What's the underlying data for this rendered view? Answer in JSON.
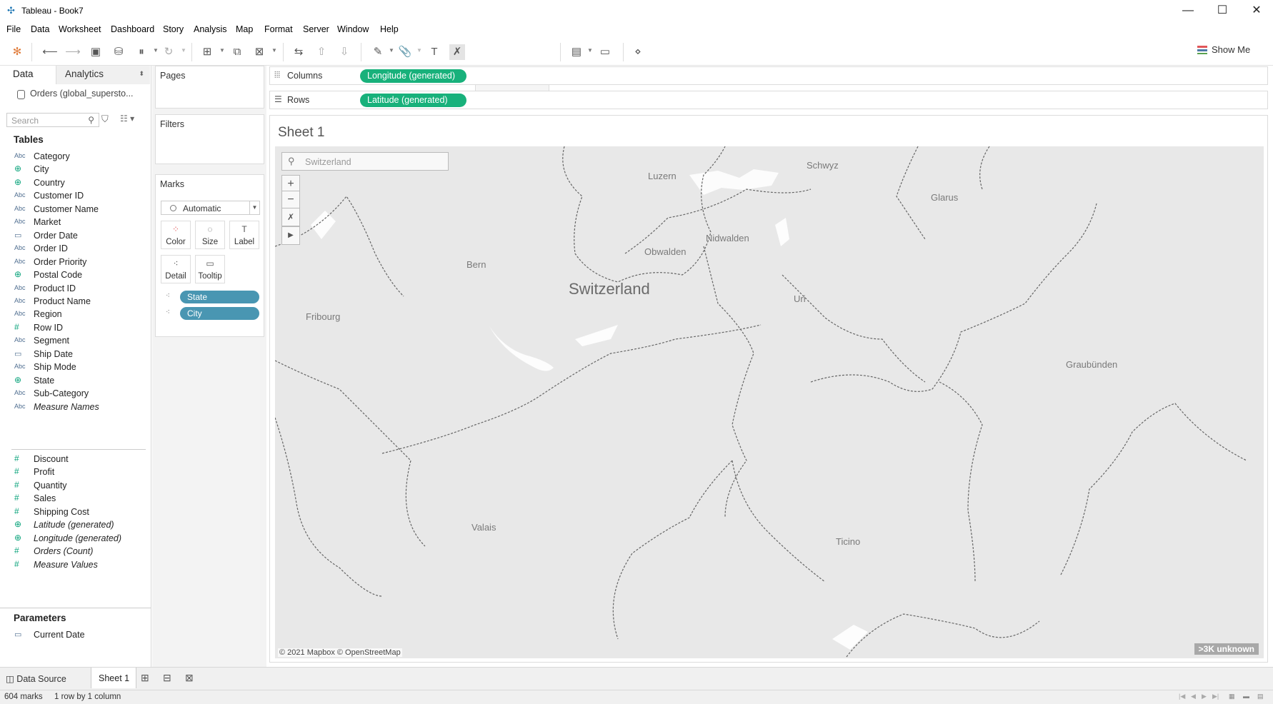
{
  "window": {
    "title": "Tableau - Book7",
    "minimize": "—",
    "maximize": "☐",
    "close": "✕"
  },
  "menu": [
    "File",
    "Data",
    "Worksheet",
    "Dashboard",
    "Story",
    "Analysis",
    "Map",
    "Format",
    "Server",
    "Window",
    "Help"
  ],
  "toolbar": {
    "show_me": "Show Me"
  },
  "data_pane": {
    "tab_data": "Data",
    "tab_analytics": "Analytics",
    "datasource": "Orders (global_supersto...",
    "search_placeholder": "Search",
    "tables_header": "Tables",
    "dimensions": [
      {
        "type": "Abc",
        "name": "Category"
      },
      {
        "type": "geo",
        "name": "City"
      },
      {
        "type": "geo",
        "name": "Country"
      },
      {
        "type": "Abc",
        "name": "Customer ID"
      },
      {
        "type": "Abc",
        "name": "Customer Name"
      },
      {
        "type": "Abc",
        "name": "Market"
      },
      {
        "type": "cal",
        "name": "Order Date"
      },
      {
        "type": "Abc",
        "name": "Order ID"
      },
      {
        "type": "Abc",
        "name": "Order Priority"
      },
      {
        "type": "geo",
        "name": "Postal Code"
      },
      {
        "type": "Abc",
        "name": "Product ID"
      },
      {
        "type": "Abc",
        "name": "Product Name"
      },
      {
        "type": "Abc",
        "name": "Region"
      },
      {
        "type": "num",
        "name": "Row ID"
      },
      {
        "type": "Abc",
        "name": "Segment"
      },
      {
        "type": "cal",
        "name": "Ship Date"
      },
      {
        "type": "Abc",
        "name": "Ship Mode"
      },
      {
        "type": "geo",
        "name": "State"
      },
      {
        "type": "Abc",
        "name": "Sub-Category"
      },
      {
        "type": "Abc",
        "name": "Measure Names",
        "italic": true
      }
    ],
    "measures": [
      {
        "type": "num",
        "name": "Discount"
      },
      {
        "type": "num",
        "name": "Profit"
      },
      {
        "type": "num",
        "name": "Quantity"
      },
      {
        "type": "num",
        "name": "Sales"
      },
      {
        "type": "num",
        "name": "Shipping Cost"
      },
      {
        "type": "geo",
        "name": "Latitude (generated)",
        "italic": true
      },
      {
        "type": "geo",
        "name": "Longitude (generated)",
        "italic": true
      },
      {
        "type": "num",
        "name": "Orders (Count)",
        "italic": true
      },
      {
        "type": "num",
        "name": "Measure Values",
        "italic": true
      }
    ],
    "parameters_header": "Parameters",
    "parameters": [
      {
        "type": "cal",
        "name": "Current Date"
      }
    ]
  },
  "cards": {
    "pages": "Pages",
    "filters": "Filters",
    "marks": "Marks",
    "mark_type": "Automatic",
    "buttons": [
      "Color",
      "Size",
      "Label",
      "Detail",
      "Tooltip"
    ],
    "pills": [
      "State",
      "City"
    ]
  },
  "shelves": {
    "columns_label": "Columns",
    "columns_pill": "Longitude (generated)",
    "rows_label": "Rows",
    "rows_pill": "Latitude (generated)"
  },
  "view": {
    "sheet_title": "Sheet 1",
    "map_search_placeholder": "Switzerland",
    "labels": [
      "Luzern",
      "Schwyz",
      "Glarus",
      "Obwalden",
      "Nidwalden",
      "Bern",
      "Switzerland",
      "Uri",
      "Fribourg",
      "Graubünden",
      "Valais",
      "Ticino"
    ],
    "attribution": "© 2021 Mapbox © OpenStreetMap",
    "unknown_badge": ">3K unknown"
  },
  "tabs": {
    "data_source": "Data Source",
    "sheet": "Sheet 1"
  },
  "status": {
    "marks": "604 marks",
    "layout": "1 row by 1 column"
  }
}
